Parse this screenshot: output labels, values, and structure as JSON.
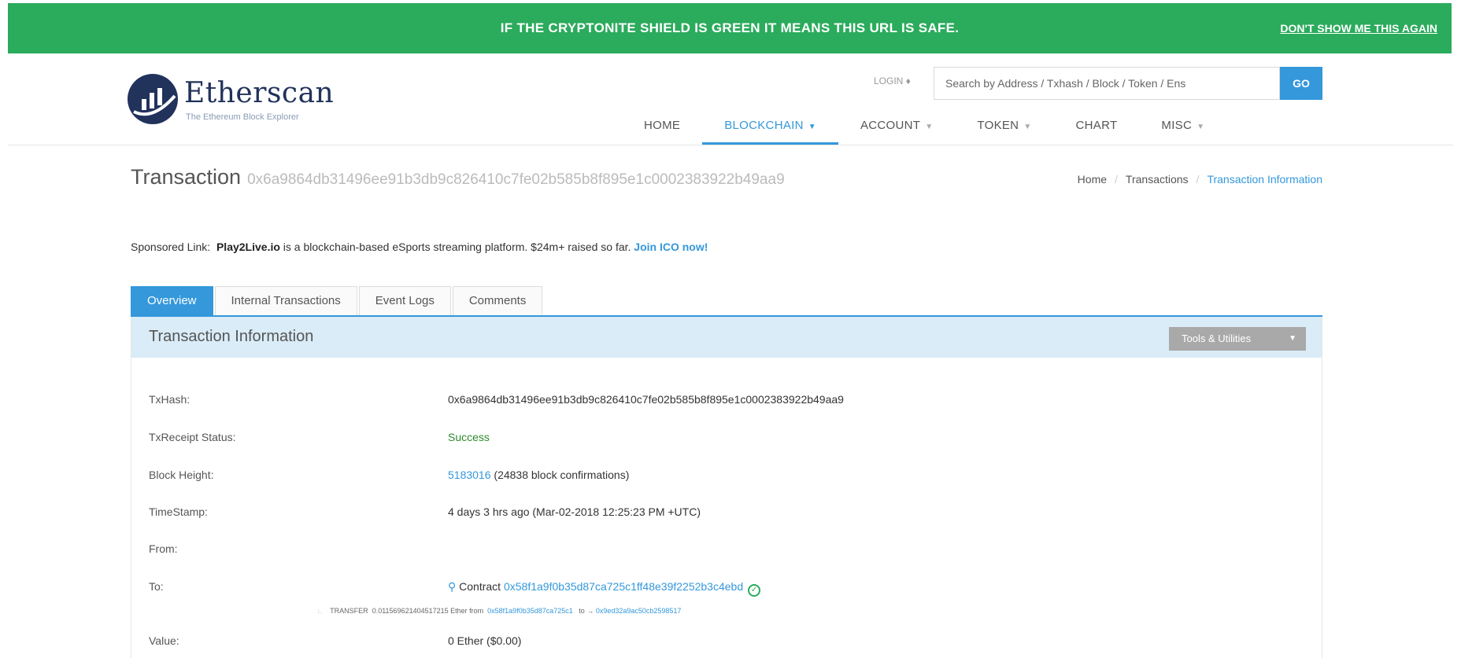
{
  "banner": {
    "message": "IF THE CRYPTONITE SHIELD IS GREEN IT MEANS THIS URL IS SAFE.",
    "dismiss": "DON'T SHOW ME THIS AGAIN"
  },
  "logo": {
    "name": "Etherscan",
    "tagline": "The Ethereum Block Explorer"
  },
  "header": {
    "login": "LOGIN",
    "search_placeholder": "Search by Address / Txhash / Block / Token / Ens",
    "go": "GO"
  },
  "nav": {
    "items": [
      {
        "label": "HOME"
      },
      {
        "label": "BLOCKCHAIN"
      },
      {
        "label": "ACCOUNT"
      },
      {
        "label": "TOKEN"
      },
      {
        "label": "CHART"
      },
      {
        "label": "MISC"
      }
    ]
  },
  "page": {
    "title": "Transaction",
    "hash": "0x6a9864db31496ee91b3db9c826410c7fe02b585b8f895e1c0002383922b49aa9"
  },
  "breadcrumb": {
    "home": "Home",
    "transactions": "Transactions",
    "current": "Transaction Information"
  },
  "sponsored": {
    "label": "Sponsored Link:",
    "name": "Play2Live.io",
    "text": "is a blockchain-based eSports streaming platform. $24m+ raised so far.",
    "cta": "Join ICO now!"
  },
  "tabs": [
    "Overview",
    "Internal Transactions",
    "Event Logs",
    "Comments"
  ],
  "panel": {
    "title": "Transaction Information",
    "tools": "Tools & Utilities"
  },
  "details": {
    "txhash_label": "TxHash:",
    "txhash": "0x6a9864db31496ee91b3db9c826410c7fe02b585b8f895e1c0002383922b49aa9",
    "status_label": "TxReceipt Status:",
    "status": "Success",
    "block_label": "Block Height:",
    "block": "5183016",
    "block_conf": "(24838 block confirmations)",
    "timestamp_label": "TimeStamp:",
    "timestamp": "4 days 3 hrs ago (Mar-02-2018 12:25:23 PM +UTC)",
    "from_label": "From:",
    "to_label": "To:",
    "to_prefix": "Contract",
    "to_address": "0x58f1a9f0b35d87ca725c1ff48e39f2252b3c4ebd",
    "transfer_label": "TRANSFER",
    "transfer_amount": "0.011569621404517215 Ether from",
    "transfer_from": "0x58f1a9f0b35d87ca725c1",
    "transfer_to_label": "to",
    "transfer_to": "0x9ed32a9ac50cb2598517",
    "value_label": "Value:",
    "value": "0 Ether ($0.00)"
  }
}
